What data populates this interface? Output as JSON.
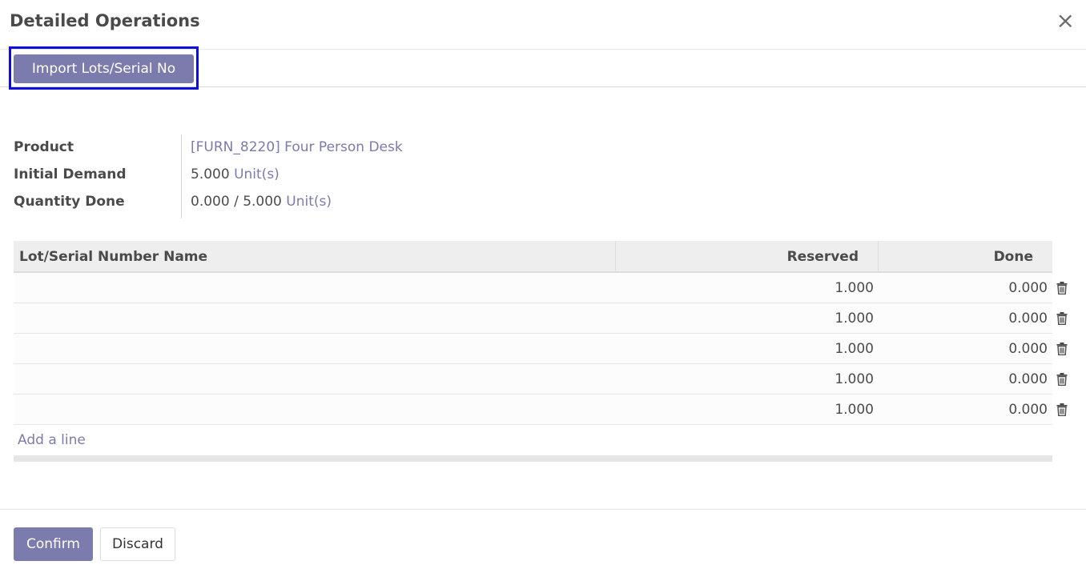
{
  "dialog": {
    "title": "Detailed Operations",
    "close_label": "×"
  },
  "toolbar": {
    "import_label": "Import Lots/Serial No"
  },
  "info": {
    "product_label": "Product",
    "product_value": "[FURN_8220] Four Person Desk",
    "demand_label": "Initial Demand",
    "demand_qty": "5.000",
    "demand_uom": "Unit(s)",
    "done_label": "Quantity Done",
    "done_qty": "0.000 / 5.000",
    "done_uom": "Unit(s)"
  },
  "table": {
    "columns": {
      "lot": "Lot/Serial Number Name",
      "reserved": "Reserved",
      "done": "Done"
    },
    "rows": [
      {
        "lot": "",
        "reserved": "1.000",
        "done": "0.000"
      },
      {
        "lot": "",
        "reserved": "1.000",
        "done": "0.000"
      },
      {
        "lot": "",
        "reserved": "1.000",
        "done": "0.000"
      },
      {
        "lot": "",
        "reserved": "1.000",
        "done": "0.000"
      },
      {
        "lot": "",
        "reserved": "1.000",
        "done": "0.000"
      }
    ],
    "add_line_label": "Add a line"
  },
  "footer": {
    "confirm_label": "Confirm",
    "discard_label": "Discard"
  },
  "colors": {
    "primary": "#7c7bad",
    "focus": "#0d0ddc"
  },
  "icons": {
    "row_delete": "trash-icon",
    "dialog_close": "close-icon"
  }
}
